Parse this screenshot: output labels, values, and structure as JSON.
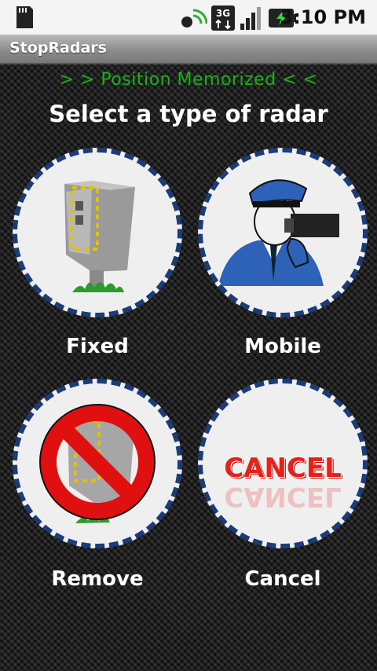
{
  "status_bar": {
    "time": "3:10 PM",
    "icons": [
      "sd-card-icon",
      "signal-icon",
      "3g-icon",
      "cell-bars-icon",
      "battery-icon"
    ]
  },
  "app": {
    "title": "StopRadars"
  },
  "main": {
    "message": "> > Position Memorized < <",
    "heading": "Select a type of radar",
    "buttons": [
      {
        "label": "Fixed",
        "icon": "fixed-radar-icon"
      },
      {
        "label": "Mobile",
        "icon": "police-officer-icon"
      },
      {
        "label": "Remove",
        "icon": "remove-radar-icon"
      },
      {
        "label": "Cancel",
        "icon": "cancel-icon",
        "image_text": "CANCEL"
      }
    ]
  },
  "colors": {
    "accent_green": "#19b019",
    "ring_blue": "#1b3c78",
    "cancel_red": "#e2231a"
  }
}
